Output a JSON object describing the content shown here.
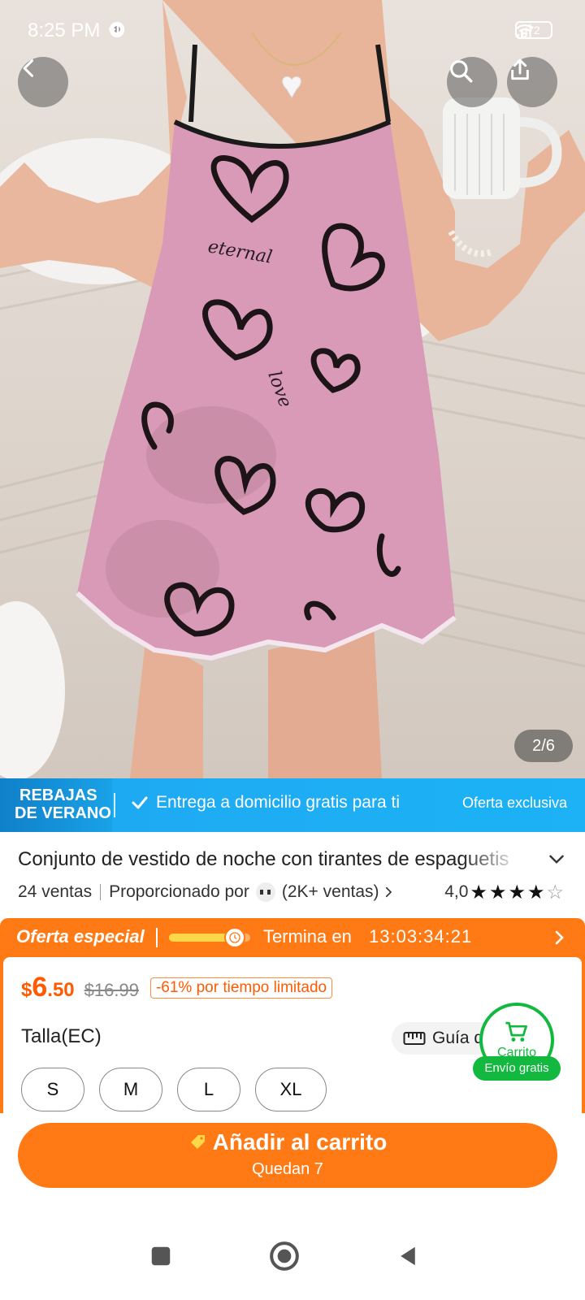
{
  "status_bar": {
    "time": "8:25 PM",
    "battery": "72",
    "left_icons": [
      "alarm-icon",
      "chrome-icon",
      "chrome-icon",
      "tiktok-icon"
    ],
    "right_icons": [
      "signal-icon",
      "wifi-icon",
      "battery-icon"
    ]
  },
  "gallery": {
    "counter": "2/6",
    "dress_text": [
      "eternal",
      "love"
    ]
  },
  "promo_banner": {
    "badge_line1": "REBAJAS",
    "badge_line2": "DE VERANO",
    "text": "Entrega a domicilio gratis para ti",
    "right": "Oferta exclusiva",
    "color": "#1fa8f2"
  },
  "product": {
    "title": "Conjunto de vestido de noche con tirantes de espaguetis",
    "sales": "24 ventas",
    "provided_by": "Proporcionado por",
    "store_sales": "(2K+ ventas)",
    "rating": "4,0",
    "stars": 4,
    "stars_max": 5
  },
  "offer": {
    "label": "Oferta especial",
    "progress": 0.78,
    "ends_label": "Termina en",
    "timer": "13:03:34:21",
    "price_currency": "$",
    "price_int": "6",
    "price_dec": ".50",
    "price_old": "$16.99",
    "discount": "-61% por tiempo limitado",
    "color": "#ff7a14"
  },
  "sizes": {
    "label": "Talla(EC)",
    "guide": "Guía de",
    "options": [
      "S",
      "M",
      "L",
      "XL"
    ]
  },
  "cart_float": {
    "label": "Carrito",
    "badge": "Envío gratis",
    "color": "#13b83f"
  },
  "add_to_cart": {
    "title": "Añadir al carrito",
    "subtitle": "Quedan 7"
  }
}
